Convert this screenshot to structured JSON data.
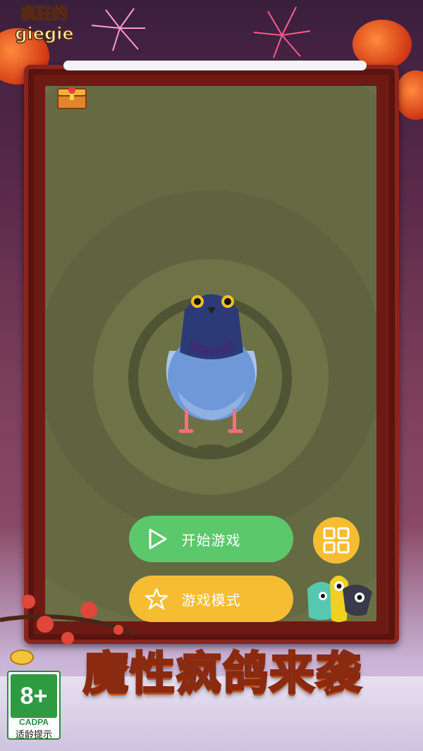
{
  "logo": {
    "line1": "疯狂的",
    "line2": "giegie"
  },
  "buttons": {
    "start_label": "开始游戏",
    "mode_label": "游戏模式"
  },
  "banner": {
    "title": "魔性疯鸽来袭"
  },
  "age_rating": {
    "value": "8+",
    "org": "CADPA",
    "caption": "适龄提示"
  },
  "icons": {
    "start": "play-icon",
    "mode": "star-icon",
    "menu": "grid-icon",
    "gift": "treasure-chest-icon"
  },
  "colors": {
    "start_button": "#5ac86b",
    "mode_button": "#f6bd32",
    "menu_button": "#f6bd32",
    "field": "#6b6f45",
    "frame": "#6e1a14"
  }
}
